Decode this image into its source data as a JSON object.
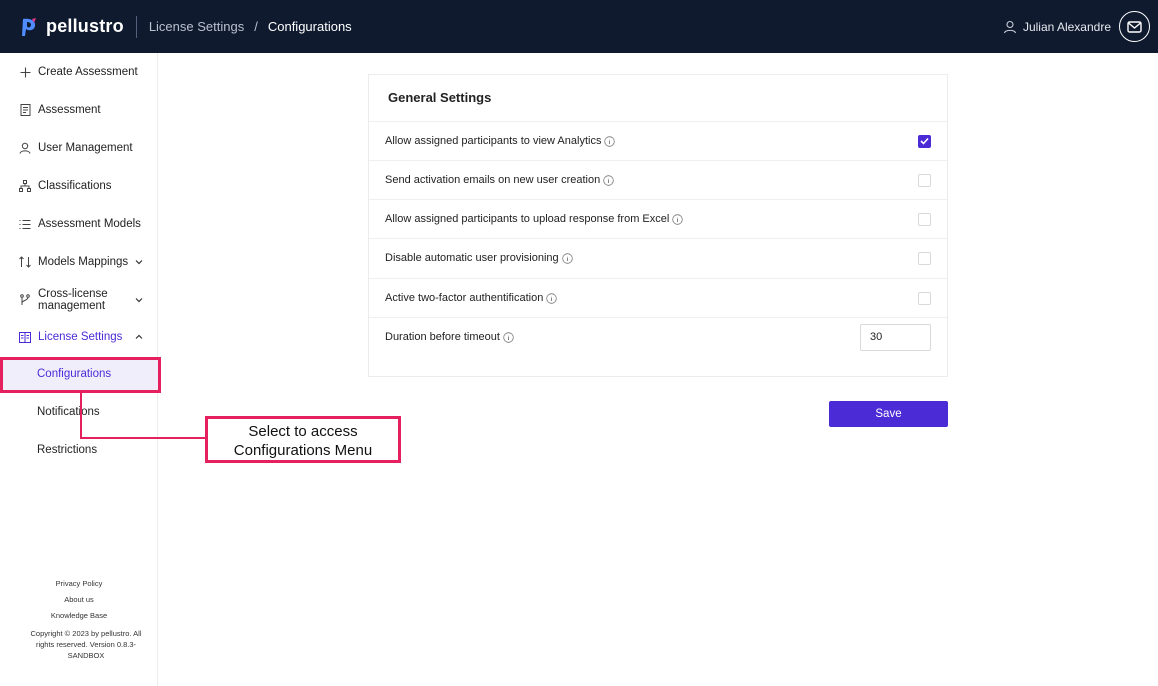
{
  "header": {
    "brand": "pellustro",
    "breadcrumb_parent": "License Settings",
    "breadcrumb_separator": "/",
    "breadcrumb_current": "Configurations",
    "user_name": "Julian Alexandre",
    "bg_color": "#0f1a2e"
  },
  "sidebar": {
    "items": [
      {
        "label": "Create Assessment",
        "icon": "plus-icon"
      },
      {
        "label": "Assessment",
        "icon": "document-icon"
      },
      {
        "label": "User Management",
        "icon": "user-icon"
      },
      {
        "label": "Classifications",
        "icon": "hierarchy-icon"
      },
      {
        "label": "Assessment Models",
        "icon": "list-icon"
      },
      {
        "label": "Models Mappings",
        "icon": "mapping-icon"
      },
      {
        "label": "Cross-license management",
        "icon": "branch-icon"
      },
      {
        "label": "License Settings",
        "icon": "settings-card-icon"
      }
    ],
    "sub_items": [
      {
        "label": "Configurations"
      },
      {
        "label": "Notifications"
      },
      {
        "label": "Restrictions"
      }
    ],
    "footer_links": [
      "Privacy Policy",
      "About us",
      "Knowledge Base"
    ],
    "copyright": "Copyright © 2023 by pellustro. All rights reserved. Version 0.8.3-SANDBOX"
  },
  "settings": {
    "title": "General Settings",
    "rows": [
      {
        "label": "Allow assigned participants to view Analytics",
        "checked": true
      },
      {
        "label": "Send activation emails on new user creation",
        "checked": false
      },
      {
        "label": "Allow assigned participants to upload response from Excel",
        "checked": false
      },
      {
        "label": "Disable automatic user provisioning",
        "checked": false
      },
      {
        "label": "Active two-factor authentification",
        "checked": false
      },
      {
        "label": "Duration before timeout",
        "value": "30"
      }
    ],
    "save_label": "Save"
  },
  "annotation": {
    "line1": "Select to access",
    "line2": "Configurations Menu",
    "color": "#e4205e"
  },
  "colors": {
    "accent": "#4b2bd6"
  }
}
